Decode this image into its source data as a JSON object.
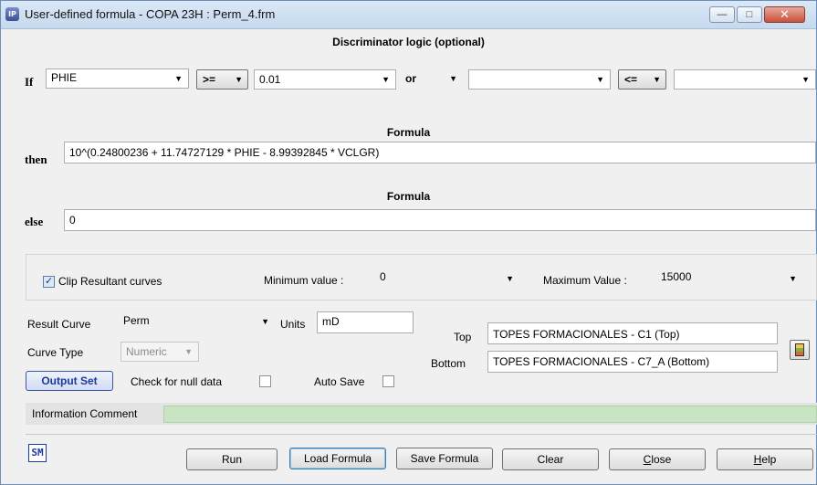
{
  "window": {
    "title": "User-defined formula - COPA 23H : Perm_4.frm",
    "icon": "ip-app-icon",
    "controls": {
      "minimize_glyph": "—",
      "maximize_glyph": "□",
      "close_glyph": "✕"
    }
  },
  "discriminator": {
    "title": "Discriminator logic (optional)",
    "if_label": "If",
    "variable": "PHIE",
    "operator1": ">=",
    "value1": "0.01",
    "logic": "or",
    "variable2": "",
    "operator2": "<=",
    "value2": ""
  },
  "then_formula": {
    "title": "Formula",
    "label": "then",
    "value": "10^(0.24800236 + 11.74727129 * PHIE - 8.99392845 * VCLGR)"
  },
  "else_formula": {
    "title": "Formula",
    "label": "else",
    "value": "0"
  },
  "clip": {
    "checkbox_label": "Clip Resultant curves",
    "checked": true,
    "min_label": "Minimum value :",
    "min_value": "0",
    "max_label": "Maximum Value :",
    "max_value": "15000"
  },
  "result": {
    "curve_label": "Result Curve",
    "curve_value": "Perm",
    "units_label": "Units",
    "units_value": "mD",
    "type_label": "Curve Type",
    "type_value": "Numeric",
    "top_label": "Top",
    "top_value": "TOPES FORMACIONALES - C1 (Top)",
    "bottom_label": "Bottom",
    "bottom_value": "TOPES FORMACIONALES - C7_A (Bottom)",
    "output_set_label": "Output Set",
    "null_check_label": "Check for null data",
    "null_check_checked": false,
    "auto_save_label": "Auto Save",
    "auto_save_checked": false
  },
  "info": {
    "label": "Information Comment",
    "value": ""
  },
  "footer": {
    "sm_label": "SM",
    "run": "Run",
    "load": "Load Formula",
    "save": "Save Formula",
    "clear": "Clear",
    "close_prefix": "",
    "close_underline": "C",
    "close_rest": "lose",
    "help_underline": "H",
    "help_rest": "elp"
  }
}
